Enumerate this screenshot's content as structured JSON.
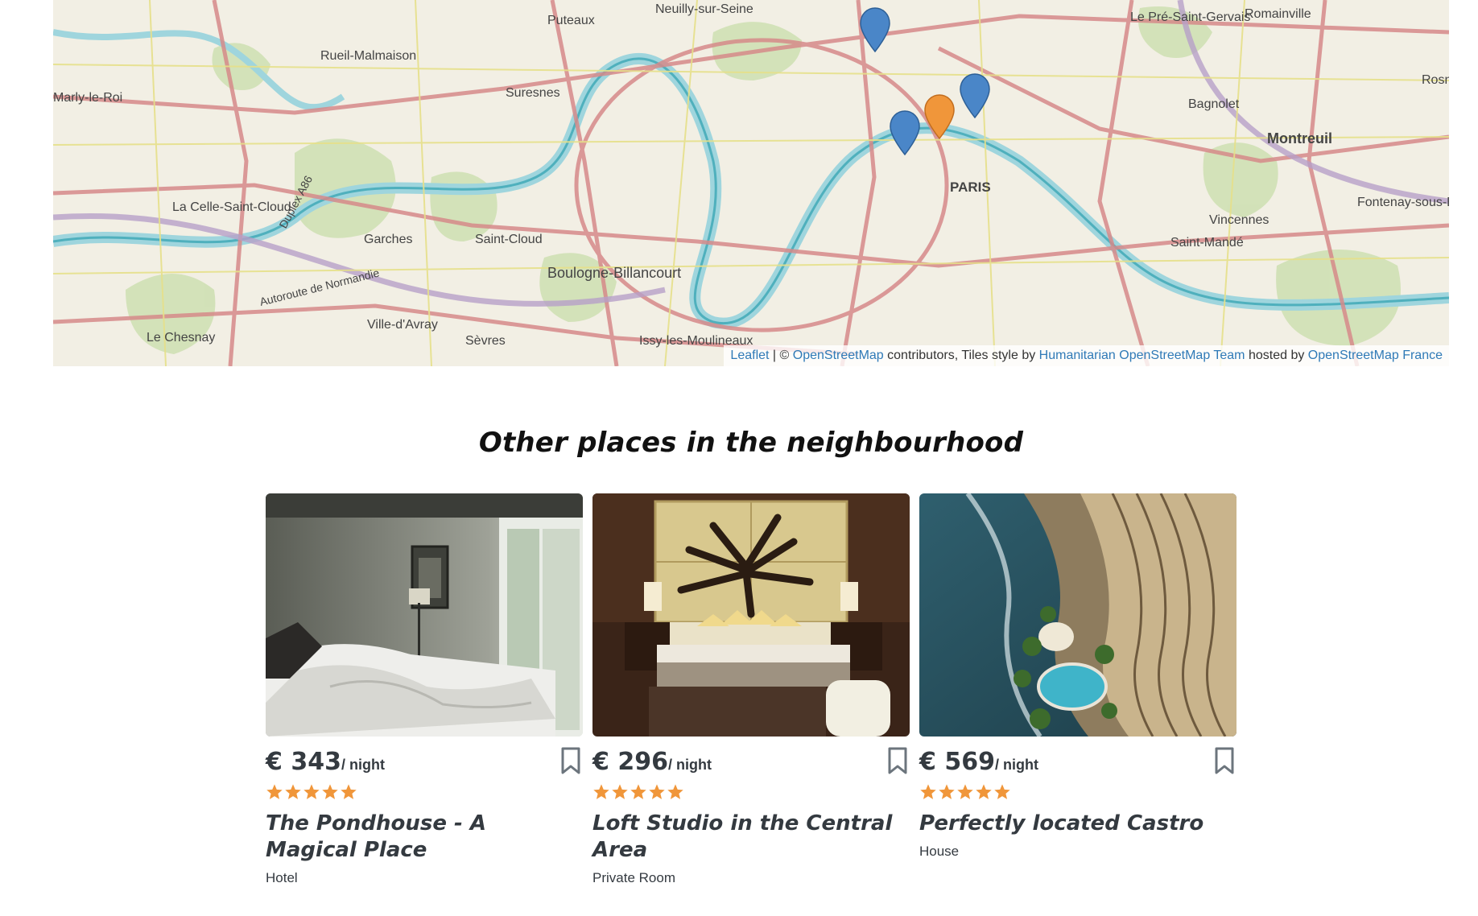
{
  "map": {
    "place_labels": [
      "Puteaux",
      "Neuilly-sur-Seine",
      "Le Pré-Saint-Gervais",
      "Romainville",
      "Rueil-Malmaison",
      "Suresnes",
      "Marly-le-Roi",
      "Bagnolet",
      "Rosny",
      "Montreuil",
      "PARIS",
      "Duplex A86",
      "La Celle-Saint-Cloud",
      "Fontenay-sous-Bois",
      "Vincennes",
      "Garches",
      "Saint-Cloud",
      "Saint-Mandé",
      "Boulogne-Billancourt",
      "Autoroute de Normandie",
      "Ville-d'Avray",
      "Le Chesnay",
      "Sèvres",
      "Issy-les-Moulineaux"
    ],
    "markers": [
      {
        "color": "#4a86c8",
        "label": "blue-marker"
      },
      {
        "color": "#4a86c8",
        "label": "blue-marker"
      },
      {
        "color": "#f0963a",
        "label": "orange-marker-active"
      },
      {
        "color": "#4a86c8",
        "label": "blue-marker"
      }
    ],
    "attribution": {
      "leaflet": "Leaflet",
      "sep": " | © ",
      "osm": "OpenStreetMap",
      "mid": " contributors, Tiles style by ",
      "hot": "Humanitarian OpenStreetMap Team",
      "hosted": " hosted by ",
      "osmfr": "OpenStreetMap France"
    }
  },
  "section": {
    "heading": "Other places in the neighbourhood"
  },
  "listings": [
    {
      "price": "€ 343",
      "per": "/ night",
      "rating": 5,
      "title": "The Pondhouse - A Magical Place",
      "type": "Hotel"
    },
    {
      "price": "€ 296",
      "per": "/ night",
      "rating": 5,
      "title": "Loft Studio in the Central Area",
      "type": "Private Room"
    },
    {
      "price": "€ 569",
      "per": "/ night",
      "rating": 5,
      "title": "Perfectly located Castro",
      "type": "House"
    }
  ],
  "colors": {
    "star": "#f0963a",
    "link": "#2f7ab7",
    "text": "#343a40"
  }
}
